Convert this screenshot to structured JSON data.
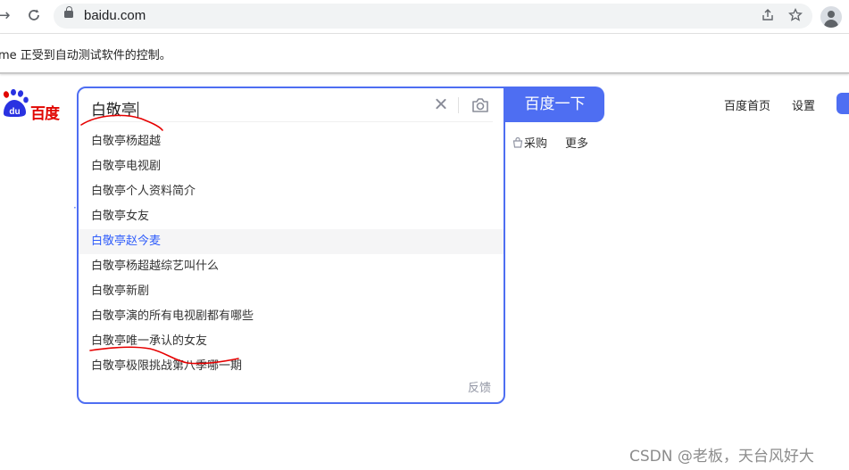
{
  "browser": {
    "url": "baidu.com",
    "infobar_text": "me 正受到自动测试软件的控制。"
  },
  "page": {
    "logo_text": "百度",
    "search": {
      "query": "白敬亭",
      "button_label": "百度一下",
      "suggestions": [
        "白敬亭杨超越",
        "白敬亭电视剧",
        "白敬亭个人资料简介",
        "白敬亭女友",
        "白敬亭赵今麦",
        "白敬亭杨超越综艺叫什么",
        "白敬亭新剧",
        "白敬亭演的所有电视剧都有哪些",
        "白敬亭唯一承认的女友",
        "白敬亭极限挑战第八季哪一期"
      ],
      "highlighted_index": 4,
      "feedback_label": "反馈"
    },
    "sub_links": {
      "caigou": "采购",
      "more": "更多"
    },
    "top_links": {
      "home": "百度首页",
      "settings": "设置"
    }
  },
  "watermark": "CSDN @老板，天台风好大",
  "colors": {
    "accent": "#4e6ef2",
    "highlight_text": "#315efb",
    "annotation": "#e60000",
    "logo_red": "#e10601"
  }
}
